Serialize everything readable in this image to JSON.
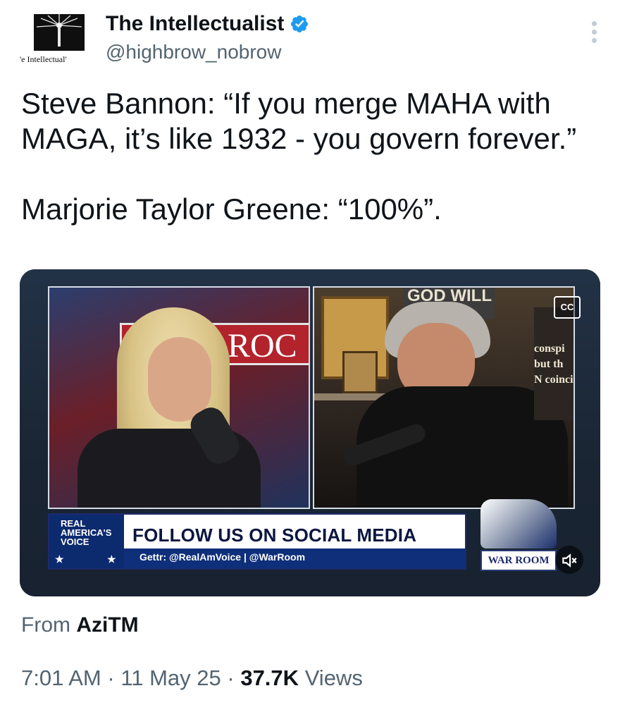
{
  "author": {
    "display_name": "The Intellectualist",
    "handle": "@highbrow_nobrow",
    "avatar_caption": "'e Intellectual'",
    "verified": true,
    "verified_color": "#1d9bf0"
  },
  "tweet": {
    "paragraphs": [
      "Steve Bannon: “If you merge MAHA with MAGA, it’s like 1932 - you govern forever.”",
      "Marjorie Taylor Greene: “100%”."
    ]
  },
  "media": {
    "cc_label": "CC",
    "left_sign_text": "ROC",
    "right_sign_text": "GOD WILL BE",
    "side_sign_text": "conspi but th N coinci",
    "lower_third": {
      "brand": "REAL AMERICA'S VOICE",
      "headline": "FOLLOW US ON SOCIAL MEDIA",
      "sub": "Gettr: @RealAmVoice | @WarRoom"
    },
    "logo_label": "WAR ROOM"
  },
  "source": {
    "prefix": "From",
    "name": "AziTM"
  },
  "meta": {
    "time": "7:01 AM",
    "date": "11 May 25",
    "views_count": "37.7K",
    "views_label": "Views"
  }
}
